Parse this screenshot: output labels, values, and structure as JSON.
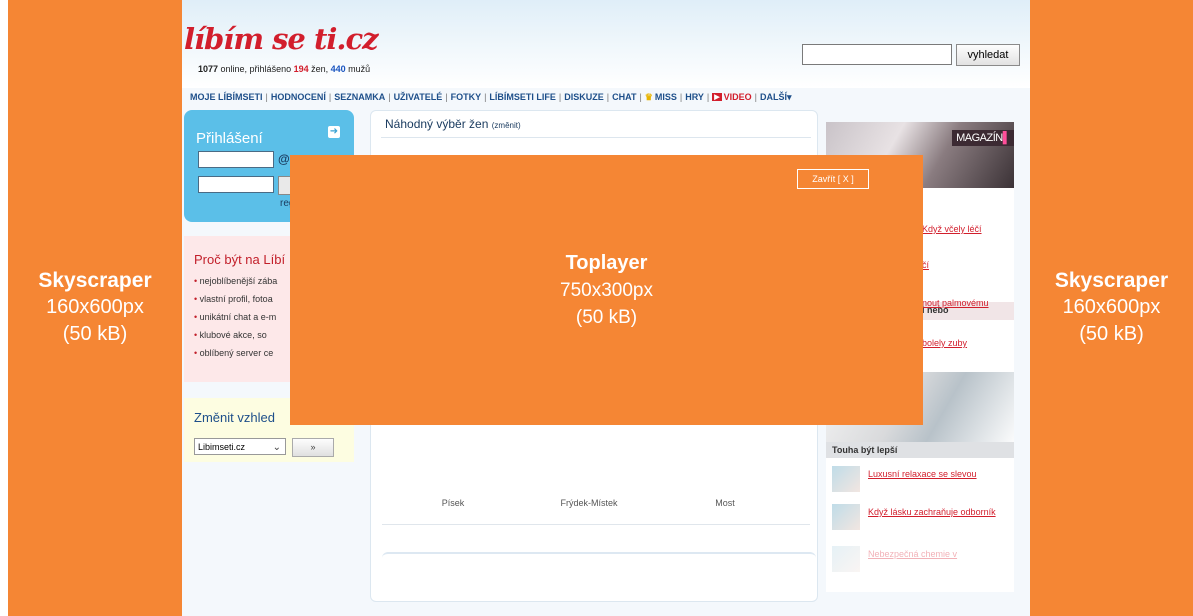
{
  "left_ad": {
    "title": "Skyscraper",
    "size": "160x600px",
    "weight": "(50 kB)"
  },
  "right_ad": {
    "title": "Skyscraper",
    "size": "160x600px",
    "weight": "(50 kB)"
  },
  "toplayer": {
    "title": "Toplayer",
    "size": "750x300px",
    "weight": "(50 kB)",
    "close": "Zavřít [ X ]"
  },
  "site": {
    "logo": "líbím se ti.cz",
    "online": {
      "count": "1077",
      "text1": " online, přihlášeno ",
      "women": "194",
      "text2": " žen, ",
      "men": "440",
      "text3": " mužů"
    },
    "search": {
      "placeholder": "",
      "button": "vyhledat"
    },
    "nav": [
      "MOJE LÍBÍMSETI",
      "HODNOCENÍ",
      "SEZNAMKA",
      "UŽIVATELÉ",
      "FOTKY",
      "LÍBÍMSETI LIFE",
      "DISKUZE",
      "CHAT",
      "MISS",
      "HRY",
      "VIDEO",
      "DALŠÍ"
    ],
    "login": {
      "title": "Přihlášení",
      "at": "@",
      "reg": "reg"
    },
    "why": {
      "title": "Proč být na Líbí",
      "items": [
        "nejoblíbenější zába",
        "vlastní profil, fotoa",
        "unikátní chat a e-m",
        "klubové akce, so",
        "oblíbený server ce"
      ]
    },
    "vzhled": {
      "title": "Změnit vzhled",
      "selected": "Libimseti.cz",
      "button": "»"
    },
    "random": {
      "title": "Náhodný výběr žen",
      "change": "(změnit)",
      "cities": [
        "Písek",
        "Frýdek-Místek",
        "Most"
      ]
    },
    "right": {
      "magazin_label": "MAGAZÍN",
      "header_partial": "l nebo",
      "links": [
        "Když včely léčí",
        "čí",
        "nout palmovému",
        "bolely zuby"
      ],
      "touha_title": "Touha být lepší",
      "touha_items": [
        "Luxusní relaxace se slevou",
        "Když lásku zachraňuje odborník",
        "Nebezpečná chemie v"
      ]
    }
  }
}
